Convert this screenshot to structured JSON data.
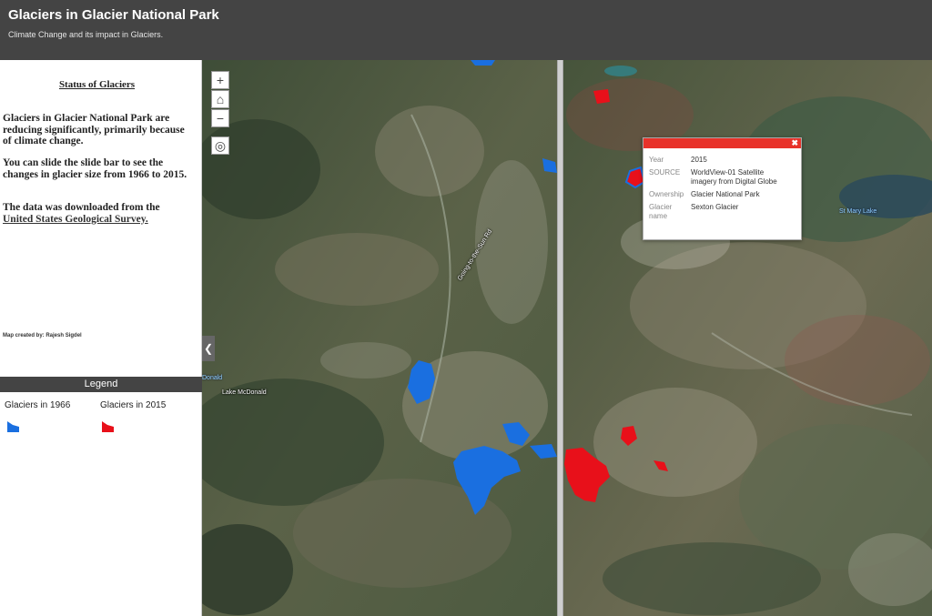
{
  "header": {
    "title": "Glaciers in Glacier National Park",
    "subtitle": "Climate Change and its impact in Glaciers."
  },
  "sidebar": {
    "heading": "Status of Glaciers",
    "para1": "Glaciers in Glacier National Park are reducing significantly, primarily because of climate change.",
    "para2": "You can slide the slide bar to see the changes in glacier size from 1966 to 2015.",
    "para3_prefix": "The data was downloaded from the",
    "para3_link": "United States Geological Survey.",
    "credit": "Map created by: Rajesh Sigdel"
  },
  "legend": {
    "title": "Legend",
    "items": [
      {
        "label": "Glaciers in 1966",
        "color": "#1a6fe0"
      },
      {
        "label": "Glaciers in 2015",
        "color": "#e8101a"
      }
    ]
  },
  "map": {
    "controls": {
      "zoom_in": "+",
      "home": "⌂",
      "zoom_out": "−",
      "locate": "◎",
      "swipe_toggle": "❮"
    },
    "labels": {
      "lake_mcdonald": "Lake McDonald",
      "donald_fragment": "Donald",
      "st_mary_lake": "St Mary Lake",
      "road": "Going-to-the-Sun Rd"
    },
    "colors": {
      "glacier_1966": "#1a6fe0",
      "glacier_2015": "#e8101a",
      "header_bg": "#444444",
      "popup_accent": "#e8322a"
    }
  },
  "popup": {
    "close_label": "✖",
    "rows": [
      {
        "key": "Year",
        "value": "2015"
      },
      {
        "key": "SOURCE",
        "value": "WorldView-01 Satellite imagery from Digital Globe"
      },
      {
        "key": "Ownership",
        "value": "Glacier National Park"
      },
      {
        "key": "Glacier name",
        "value": "Sexton Glacier"
      }
    ]
  }
}
